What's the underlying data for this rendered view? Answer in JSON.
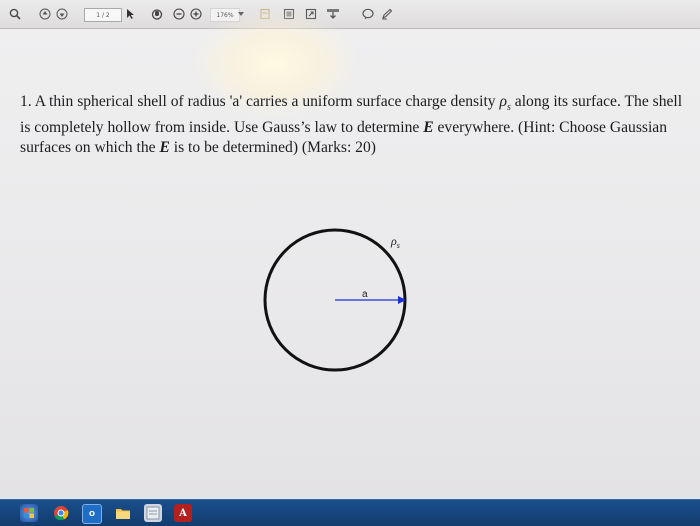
{
  "toolbar": {
    "page_indicator": "1 / 2",
    "zoom_level": "176%",
    "icons": [
      "search-icon",
      "page-up-icon",
      "page-down-icon",
      "select-arrow-icon",
      "hand-tool-icon",
      "zoom-out-icon",
      "zoom-in-icon",
      "zoom-dropdown-icon",
      "fit-page-icon",
      "fit-width-icon",
      "fullscreen-icon",
      "attach-icon",
      "comment-icon",
      "pen-icon"
    ]
  },
  "document": {
    "question_part1": "1. A thin spherical shell of radius 'a' carries a uniform surface charge density ",
    "rho_symbol": "ρ",
    "rho_subscript": "s",
    "question_part2": " along its surface. The shell is completely hollow from inside. Use Gauss’s law to determine ",
    "e_symbol_1": "E",
    "question_part3": " everywhere. (Hint: Choose Gaussian surfaces on which the ",
    "e_symbol_2": "E",
    "question_part4": " is to be determined) (Marks: 20)"
  },
  "diagram": {
    "radius_label": "a",
    "charge_label": "ρ",
    "charge_subscript": "s",
    "arrow_color": "#1a2fd6",
    "circle_color": "#111111"
  },
  "taskbar": {
    "icons": [
      "start-icon",
      "chrome-icon",
      "outlook-icon",
      "explorer-icon",
      "app-icon",
      "acrobat-icon"
    ],
    "outlook_label": "O",
    "acrobat_label": "A"
  }
}
